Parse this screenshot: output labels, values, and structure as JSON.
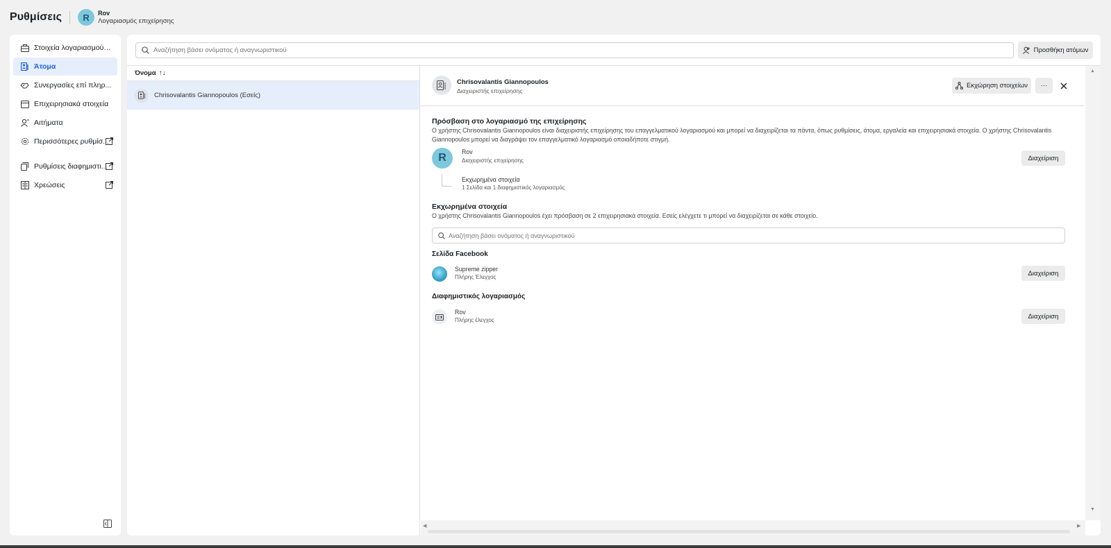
{
  "header": {
    "title": "Ρυθμίσεις",
    "account_initial": "R",
    "account_name": "Rov",
    "account_type": "Λογαριασμός επιχείρησης"
  },
  "sidebar": {
    "items": [
      {
        "label": "Στοιχεία λογαριασμού ε...",
        "icon": "briefcase-icon",
        "active": false
      },
      {
        "label": "Άτομα",
        "icon": "people-icon",
        "active": true
      },
      {
        "label": "Συνεργασίες επί πληρ...",
        "icon": "handshake-icon",
        "active": false
      },
      {
        "label": "Επιχειρησιακά στοιχεία",
        "icon": "assets-icon",
        "active": false
      },
      {
        "label": "Αιτήματα",
        "icon": "person-request-icon",
        "active": false
      },
      {
        "label": "Περισσότερες ρυθμίσ...",
        "icon": "gear-icon",
        "active": false,
        "external": true
      },
      {
        "label": "Ρυθμίσεις διαφημιστι...",
        "icon": "ads-settings-icon",
        "active": false,
        "external": true
      },
      {
        "label": "Χρεώσεις",
        "icon": "billing-icon",
        "active": false,
        "external": true
      }
    ]
  },
  "toolbar": {
    "search_placeholder": "Αναζήτηση βάσει ονόματος ή αναγνωριστικού",
    "add_people_label": "Προσθήκη ατόμων"
  },
  "list": {
    "column_header": "Όνομα",
    "sort_indicator": "↑↓",
    "rows": [
      {
        "name": "Chrisovalantis Giannopoulos (Εσείς)"
      }
    ]
  },
  "detail": {
    "name": "Chrisovalantis Giannopoulos",
    "role": "Διαχειριστής επιχείρησης",
    "assign_label": "Εκχώρηση στοιχείων",
    "more_label": "···",
    "close_label": "✕",
    "access_section": {
      "title": "Πρόσβαση στο λογαριασμό της επιχείρησης",
      "description": "Ο χρήστης Chrisovalantis Giannopoulos είναι διαχειριστής επιχείρησης του επαγγελματικού λογαριασμού και μπορεί να διαχειρίζεται τα πάντα, όπως ρυθμίσεις, άτομα, εργαλεία και επιχειρησιακά στοιχεία. Ο χρήστης Chrisovalantis Giannopoulos μπορεί να διαγράψει τον επαγγελματικό λογαριασμό οποιαδήποτε στιγμή.",
      "person_initial": "R",
      "person_name": "Rov",
      "person_role": "Διαχειριστής επιχείρησης",
      "manage_label": "Διαχείριση",
      "assigned_title": "Εκχωρημένα στοιχεία",
      "assigned_summary": "1 Σελίδα και 1 διαφημιστικός λογαριασμός"
    },
    "assets_section": {
      "title": "Εκχωρημένα στοιχεία",
      "description": "Ο χρήστης Chrisovalantis Giannopoulos έχει πρόσβαση σε 2 επιχειρησιακά στοιχεία. Εσείς ελέγχετε τι μπορεί να διαχειρίζεται σε κάθε στοιχείο.",
      "search_placeholder": "Αναζήτηση βάσει ονόματος ή αναγνωριστικού"
    },
    "facebook_page": {
      "group_title": "Σελίδα Facebook",
      "name": "Supreme zipper",
      "access": "Πλήρης Έλεγχος",
      "manage_label": "Διαχείριση"
    },
    "ad_account": {
      "group_title": "Διαφημιστικός λογαριασμός",
      "name": "Rov",
      "access": "Πλήρης έλεγχος",
      "manage_label": "Διαχείριση"
    }
  },
  "colors": {
    "accent": "#1b60e0",
    "active_bg": "#e6eefc",
    "avatar_bg": "#7ec8dd"
  }
}
